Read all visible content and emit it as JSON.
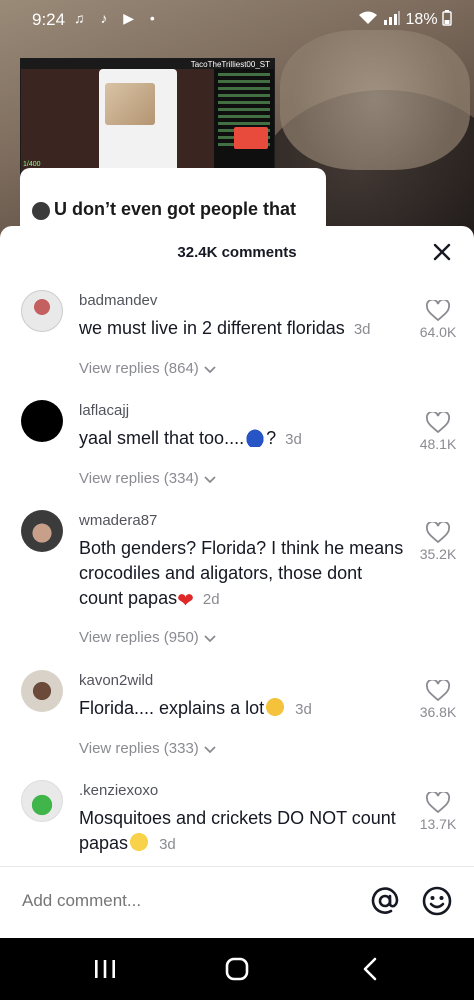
{
  "status_bar": {
    "time": "9:24",
    "left_icons": "♫ ♪ ▶ •",
    "battery": "18%"
  },
  "video": {
    "stream_handle": "TacoTheTrilliest00_ST",
    "stream_sub_count": "1/400",
    "caption": "U don’t even got people that"
  },
  "comments_panel": {
    "title": "32.4K comments",
    "comments": [
      {
        "username": "badmandev",
        "text": "we must live in 2 different floridas",
        "date": "3d",
        "likes": "64.0K",
        "replies_label": "View replies (864)"
      },
      {
        "username": "laflacajj",
        "text": "yaal smell that too....",
        "text_suffix": "?",
        "date": "3d",
        "likes": "48.1K",
        "replies_label": "View replies (334)"
      },
      {
        "username": "wmadera87",
        "text": "Both genders? Florida? I think he means crocodiles and aligators, those dont count papas",
        "date": "2d",
        "likes": "35.2K",
        "replies_label": "View replies (950)"
      },
      {
        "username": "kavon2wild",
        "text": "Florida.... explains a lot",
        "date": "3d",
        "likes": "36.8K",
        "replies_label": "View replies (333)"
      },
      {
        "username": ".kenziexoxo",
        "text": "Mosquitoes and crickets DO NOT count papas",
        "date": "3d",
        "likes": "13.7K"
      }
    ],
    "add_comment_placeholder": "Add comment..."
  },
  "icons": {
    "close": "close-icon",
    "like": "heart-outline-icon",
    "mention": "at-sign-icon",
    "emoji": "smiley-icon",
    "nav_recents": "recents-icon",
    "nav_home": "home-icon",
    "nav_back": "back-icon"
  },
  "colors": {
    "sheet_bg": "#ffffff",
    "text_primary": "#161823",
    "text_secondary": "#8a8b91",
    "nav_bar_bg": "#000000"
  }
}
